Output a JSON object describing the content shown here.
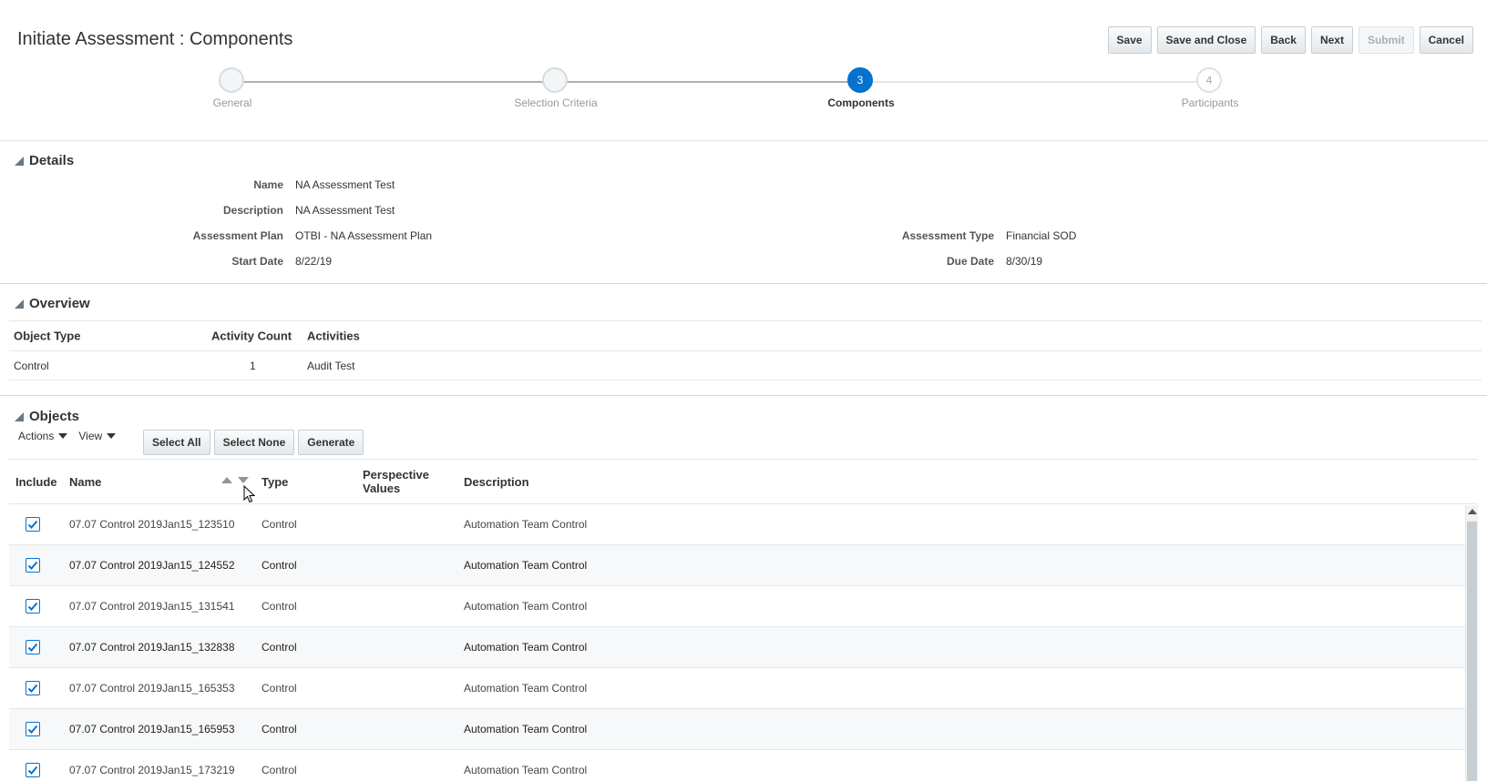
{
  "header": {
    "title": "Initiate Assessment : Components",
    "buttons": {
      "save": "Save",
      "save_close": "Save and Close",
      "back": "Back",
      "next": "Next",
      "submit": "Submit",
      "cancel": "Cancel"
    }
  },
  "train": {
    "stops": [
      {
        "label": "General",
        "number": "",
        "state": "visited"
      },
      {
        "label": "Selection Criteria",
        "number": "",
        "state": "visited"
      },
      {
        "label": "Components",
        "number": "3",
        "state": "active"
      },
      {
        "label": "Participants",
        "number": "4",
        "state": "future"
      }
    ]
  },
  "details": {
    "title": "Details",
    "name_label": "Name",
    "name_value": "NA Assessment Test",
    "description_label": "Description",
    "description_value": "NA Assessment Test",
    "plan_label": "Assessment Plan",
    "plan_value": "OTBI - NA Assessment Plan",
    "start_label": "Start Date",
    "start_value": "8/22/19",
    "type_label": "Assessment Type",
    "type_value": "Financial SOD",
    "due_label": "Due Date",
    "due_value": "8/30/19"
  },
  "overview": {
    "title": "Overview",
    "columns": [
      "Object Type",
      "Activity Count",
      "Activities"
    ],
    "rows": [
      {
        "object_type": "Control",
        "activity_count": "1",
        "activities": "Audit Test"
      }
    ]
  },
  "objects": {
    "title": "Objects",
    "actions_label": "Actions",
    "view_label": "View",
    "select_all": "Select All",
    "select_none": "Select None",
    "generate": "Generate",
    "columns": {
      "include": "Include",
      "name": "Name",
      "type": "Type",
      "perspective_line1": "Perspective",
      "perspective_line2": "Values",
      "description": "Description"
    },
    "rows": [
      {
        "included": true,
        "name": "07.07 Control 2019Jan15_123510",
        "type": "Control",
        "perspective": "",
        "description": "Automation Team Control"
      },
      {
        "included": true,
        "name": "07.07 Control 2019Jan15_124552",
        "type": "Control",
        "perspective": "",
        "description": "Automation Team Control"
      },
      {
        "included": true,
        "name": "07.07 Control 2019Jan15_131541",
        "type": "Control",
        "perspective": "",
        "description": "Automation Team Control"
      },
      {
        "included": true,
        "name": "07.07 Control 2019Jan15_132838",
        "type": "Control",
        "perspective": "",
        "description": "Automation Team Control"
      },
      {
        "included": true,
        "name": "07.07 Control 2019Jan15_165353",
        "type": "Control",
        "perspective": "",
        "description": "Automation Team Control"
      },
      {
        "included": true,
        "name": "07.07 Control 2019Jan15_165953",
        "type": "Control",
        "perspective": "",
        "description": "Automation Team Control"
      },
      {
        "included": true,
        "name": "07.07 Control 2019Jan15_173219",
        "type": "Control",
        "perspective": "",
        "description": "Automation Team Control"
      }
    ]
  },
  "colors": {
    "accent": "#0572ce",
    "border": "#e3e7ea"
  }
}
